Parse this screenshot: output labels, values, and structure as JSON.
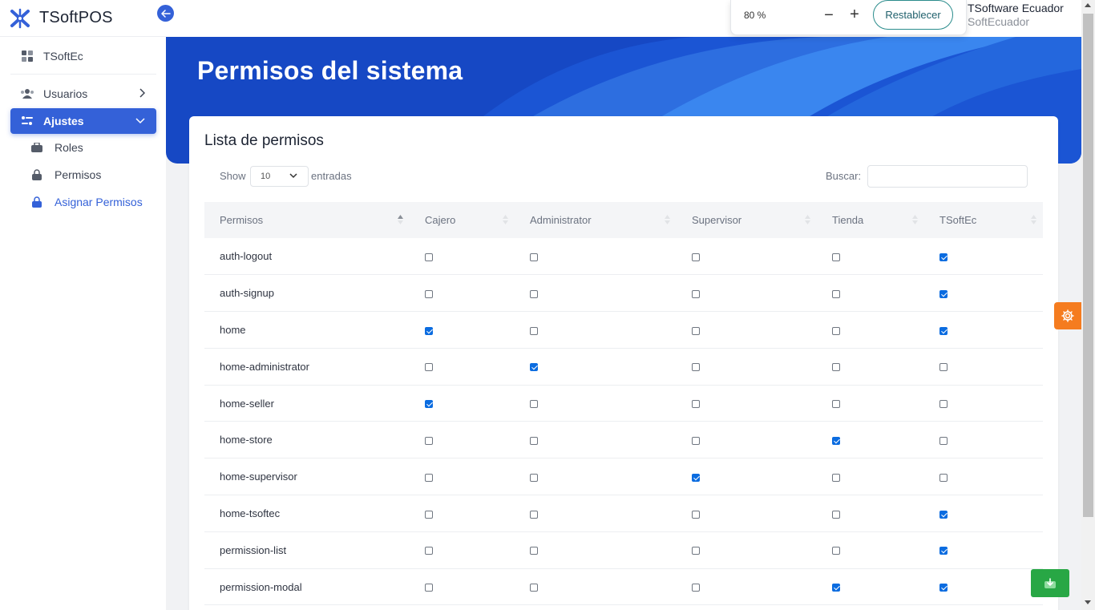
{
  "app": {
    "name": "TSoftPOS"
  },
  "sidebar": {
    "items": [
      {
        "label": "TSoftEc",
        "icon": "dashboard-icon"
      },
      {
        "label": "Usuarios",
        "icon": "users-icon"
      },
      {
        "label": "Ajustes",
        "icon": "settings-sliders-icon",
        "active": true
      }
    ],
    "subitems": [
      {
        "label": "Roles",
        "icon": "briefcase-icon"
      },
      {
        "label": "Permisos",
        "icon": "lock-icon"
      },
      {
        "label": "Asignar Permisos",
        "icon": "lock-icon",
        "current": true
      }
    ]
  },
  "topbar": {
    "zoom": {
      "value": "80 %",
      "minus": "−",
      "plus": "+",
      "reset_label": "Restablecer"
    },
    "user": {
      "name": "TSoftware Ecuador",
      "org": "SoftEcuador"
    }
  },
  "hero": {
    "title": "Permisos del sistema"
  },
  "card": {
    "title": "Lista de permisos",
    "show_label": "Show",
    "page_length": "10",
    "entries_label": "entradas",
    "search_label": "Buscar:",
    "search_value": ""
  },
  "table": {
    "columns": [
      "Permisos",
      "Cajero",
      "Administrator",
      "Supervisor",
      "Tienda",
      "TSoftEc"
    ],
    "rows": [
      {
        "permission": "auth-logout",
        "values": [
          false,
          false,
          false,
          false,
          true
        ]
      },
      {
        "permission": "auth-signup",
        "values": [
          false,
          false,
          false,
          false,
          true
        ]
      },
      {
        "permission": "home",
        "values": [
          true,
          false,
          false,
          false,
          true
        ]
      },
      {
        "permission": "home-administrator",
        "values": [
          false,
          true,
          false,
          false,
          false
        ]
      },
      {
        "permission": "home-seller",
        "values": [
          true,
          false,
          false,
          false,
          false
        ]
      },
      {
        "permission": "home-store",
        "values": [
          false,
          false,
          false,
          true,
          false
        ]
      },
      {
        "permission": "home-supervisor",
        "values": [
          false,
          false,
          true,
          false,
          false
        ]
      },
      {
        "permission": "home-tsoftec",
        "values": [
          false,
          false,
          false,
          false,
          true
        ]
      },
      {
        "permission": "permission-list",
        "values": [
          false,
          false,
          false,
          false,
          true
        ]
      },
      {
        "permission": "permission-modal",
        "values": [
          false,
          false,
          false,
          true,
          true
        ]
      }
    ]
  },
  "colors": {
    "primary": "#3461d8",
    "hero": "#1648c4",
    "settings": "#f57c1f",
    "download": "#28a745",
    "checkbox": "#0b6ce0"
  }
}
